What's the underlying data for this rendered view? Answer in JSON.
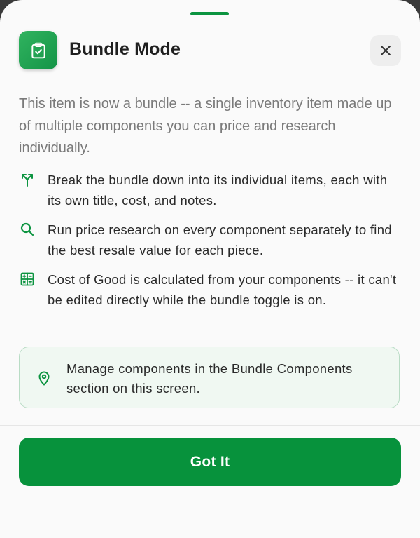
{
  "sheet": {
    "title": "Bundle Mode",
    "app_icon": "clipboard-check-icon",
    "close_icon": "close-icon",
    "accent_color": "#07923c"
  },
  "intro": "This item is now a bundle -- a single inventory item made up of multiple components you can price and research individually.",
  "features": [
    {
      "icon": "split-arrows-icon",
      "text": "Break the bundle down into its individual items, each with its own title, cost, and notes."
    },
    {
      "icon": "search-icon",
      "text": "Run price research on every component separately to find the best resale value for each piece."
    },
    {
      "icon": "calculator-icon",
      "text": "Cost of Good is calculated from your components -- it can't be edited directly while the bundle toggle is on."
    }
  ],
  "note": {
    "icon": "location-pin-icon",
    "text": "Manage components in the Bundle Components section on this screen."
  },
  "primary_button": {
    "label": "Got It"
  }
}
